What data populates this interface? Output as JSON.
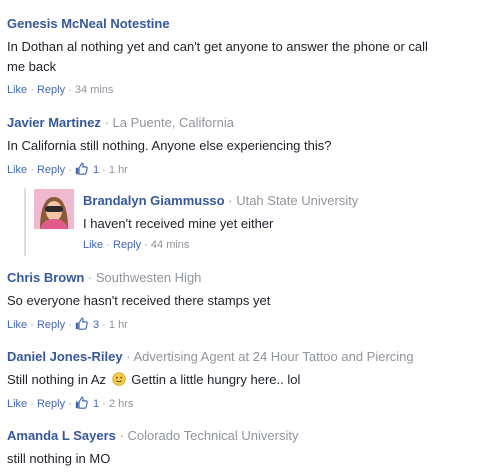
{
  "actions": {
    "like": "Like",
    "reply": "Reply",
    "dot": "·"
  },
  "comments": [
    {
      "author": "Genesis McNeal Notestine",
      "affiliation": "",
      "text": "In Dothan al nothing yet and can't get anyone to answer the phone or call me back",
      "text_line1": "In Dothan al nothing yet and can't get anyone to answer the phone or call",
      "text_line2": "me back",
      "likes": "",
      "time": "34 mins"
    },
    {
      "author": "Javier Martinez",
      "affiliation": "La Puente, California",
      "text": "In California still nothing. Anyone else experiencing this?",
      "likes": "1",
      "time": "1 hr"
    },
    {
      "author": "Brandalyn Giammusso",
      "affiliation": "Utah State University",
      "text": "I haven't received mine yet either",
      "likes": "",
      "time": "44 mins",
      "is_reply": true
    },
    {
      "author": "Chris Brown",
      "affiliation": "Southwesten High",
      "text": "So everyone hasn't received there stamps yet",
      "likes": "3",
      "time": "1 hr"
    },
    {
      "author": "Daniel Jones-Riley",
      "affiliation": "Advertising Agent at 24 Hour Tattoo and Piercing",
      "text_before": "Still nothing in Az",
      "text_after": "Gettin a little hungry here.. lol",
      "likes": "1",
      "time": "2 hrs"
    },
    {
      "author": "Amanda L Sayers",
      "affiliation": "Colorado Technical University",
      "text": "still nothing in MO"
    }
  ],
  "colors": {
    "author": "#365899",
    "meta": "#90949c",
    "link": "#4267b2",
    "text": "#1d2129",
    "reply_border": "#dcdee3"
  },
  "icons": {
    "like": "thumbs-up-icon",
    "smiley": "slightly-smiling-face-icon",
    "avatar": "profile-photo"
  }
}
